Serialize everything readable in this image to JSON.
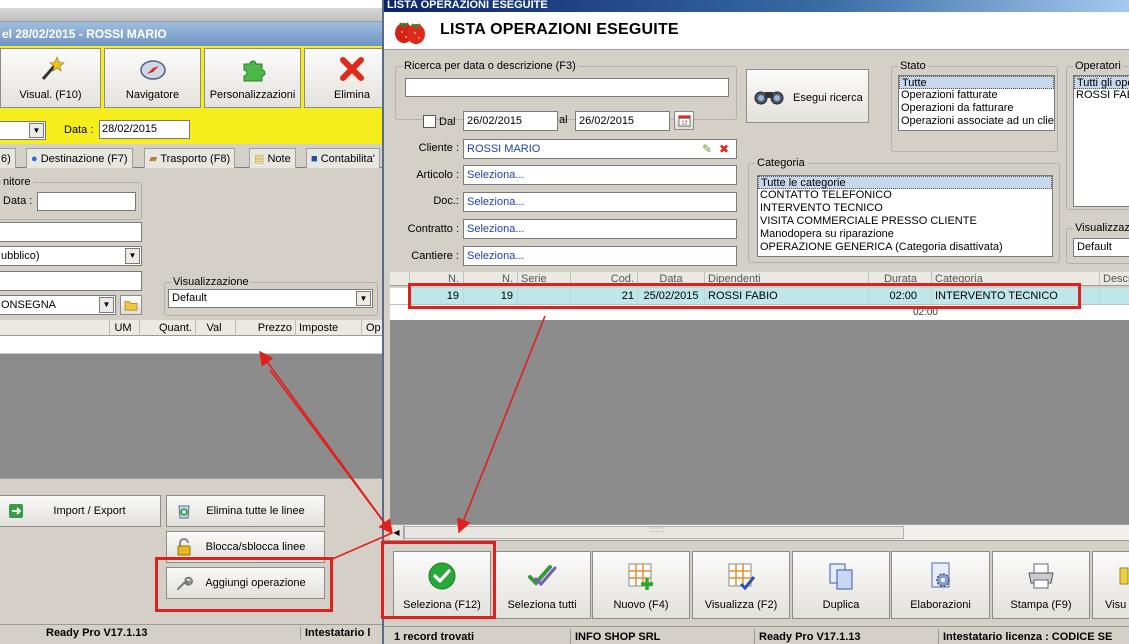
{
  "background_window": {
    "header_title": "el 28/02/2015 - ROSSI MARIO",
    "toolbar": [
      {
        "label": "Visual. (F10)",
        "icon": "magic-wand-icon"
      },
      {
        "label": "Navigatore",
        "icon": "compass-icon"
      },
      {
        "label": "Personalizzazioni",
        "icon": "puzzle-icon"
      },
      {
        "label": "Elimina",
        "icon": "red-x-icon"
      }
    ],
    "date_label": "Data :",
    "date_value": "28/02/2015",
    "tabs": [
      "6)",
      "Destinazione (F7)",
      "Trasporto (F8)",
      "Note",
      "Contabilita'"
    ],
    "supplier_group": {
      "legend": "nitore",
      "data_label": "Data :",
      "payment_value": "ubblico)",
      "delivery_value": "ONSEGNA"
    },
    "visualizzazione": {
      "legend": "Visualizzazione",
      "value": "Default"
    },
    "grid_columns": [
      "UM",
      "Quant.",
      "Val",
      "Prezzo",
      "Imposte",
      "Op"
    ],
    "actions": {
      "import_export": "Import / Export",
      "delete_all_lines": "Elimina tutte le linee",
      "lock_unlock_lines": "Blocca/sblocca linee",
      "add_operation": "Aggiungi operazione"
    },
    "status": [
      "Ready Pro V17.1.13",
      "Intestatario l"
    ]
  },
  "dialog": {
    "window_title": "LISTA OPERAZIONI ESEGUITE",
    "header_title": "LISTA OPERAZIONI ESEGUITE",
    "search": {
      "legend": "Ricerca per data o descrizione (F3)",
      "value": "",
      "dal_label": "Dal",
      "dal_checked": false,
      "date_from": "26/02/2015",
      "al_label": "al",
      "date_to": "26/02/2015",
      "run_button": "Esegui ricerca"
    },
    "filters": [
      {
        "label": "Cliente :",
        "value": "ROSSI MARIO"
      },
      {
        "label": "Articolo :",
        "value": "Seleziona..."
      },
      {
        "label": "Doc.:",
        "value": "Seleziona..."
      },
      {
        "label": "Contratto :",
        "value": "Seleziona..."
      },
      {
        "label": "Cantiere :",
        "value": "Seleziona..."
      }
    ],
    "stato": {
      "legend": "Stato",
      "options": [
        "Tutte",
        "Operazioni fatturate",
        "Operazioni da fatturare",
        "Operazioni associate ad un clien"
      ],
      "selected_index": 0
    },
    "operatori": {
      "legend": "Operatori",
      "options": [
        "Tutti gli ope",
        "ROSSI FABIO"
      ],
      "selected_index": 0
    },
    "categoria": {
      "legend": "Categoria",
      "options": [
        "Tutte le categorie",
        "CONTATTO TELEFONICO",
        "INTERVENTO TECNICO",
        "VISITA COMMERCIALE PRESSO CLIENTE",
        "Manodopera su riparazione",
        "OPERAZIONE GENERICA (Categoria disattivata)"
      ],
      "selected_index": 0
    },
    "visualizzazione": {
      "legend": "Visualizzazio",
      "value": "Default"
    },
    "grid": {
      "columns": [
        "N.",
        "N.",
        "Serie",
        "Cod.",
        "Data",
        "Dipendenti",
        "Durata",
        "Categoria",
        "Descri"
      ],
      "rows": [
        [
          "19",
          "19",
          "",
          "21",
          "25/02/2015",
          "ROSSI FABIO",
          "02:00",
          "INTERVENTO TECNICO",
          ""
        ]
      ],
      "total_row": [
        "",
        "",
        "",
        "",
        "",
        "",
        "02:00",
        "",
        ""
      ]
    },
    "actions": [
      {
        "label": "Seleziona (F12)",
        "icon": "green-check-circle-icon"
      },
      {
        "label": "Seleziona tutti",
        "icon": "double-check-icon"
      },
      {
        "label": "Nuovo (F4)",
        "icon": "grid-plus-icon"
      },
      {
        "label": "Visualizza (F2)",
        "icon": "grid-check-icon"
      },
      {
        "label": "Duplica",
        "icon": "duplicate-docs-icon"
      },
      {
        "label": "Elaborazioni",
        "icon": "gear-document-icon"
      },
      {
        "label": "Stampa (F9)",
        "icon": "printer-icon"
      },
      {
        "label": "Visu",
        "icon": "view-icon"
      }
    ],
    "status": [
      "1 record trovati",
      "INFO SHOP SRL",
      "Ready Pro V17.1.13",
      "Intestatario licenza : CODICE SE"
    ]
  },
  "colors": {
    "yellow_toolbar": "#f5ee1c",
    "selected_row": "#bfe6e8",
    "highlight_red": "#e0201c",
    "header_blue": "#6f95c4"
  }
}
